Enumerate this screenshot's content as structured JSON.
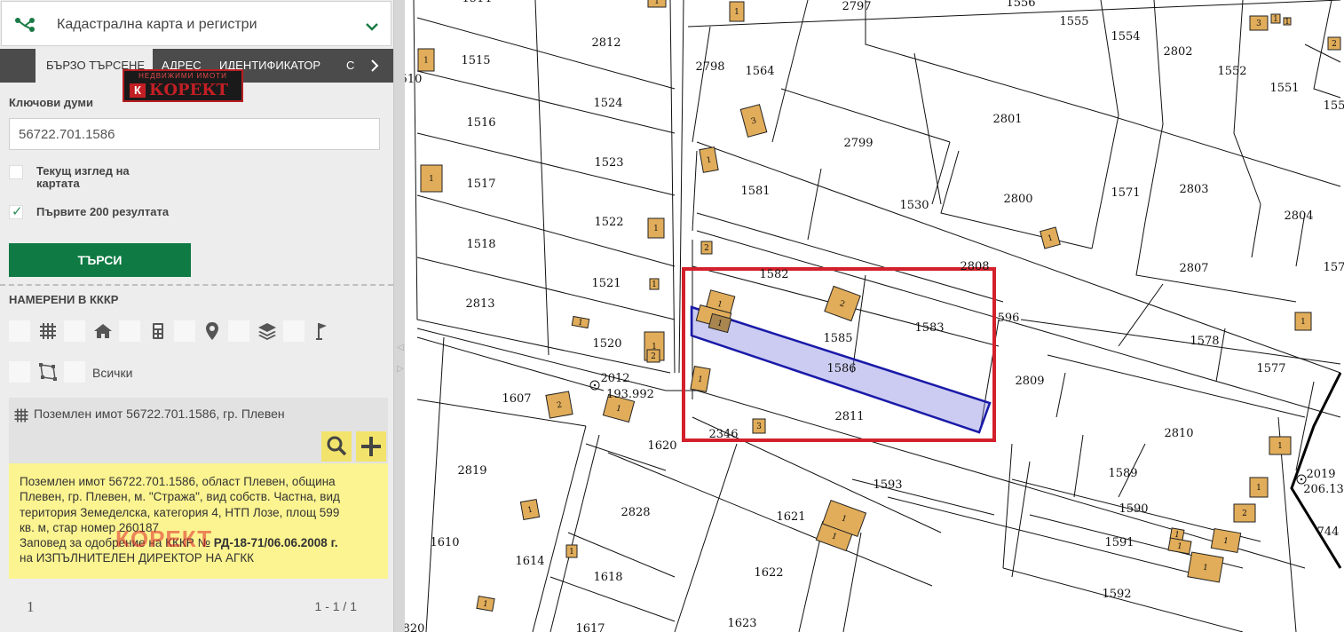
{
  "layer_selector": {
    "label": "Кадастрална карта и регистри",
    "icon": "layers-tree-icon",
    "chevron": "chevron-down-icon"
  },
  "tabs": [
    {
      "label": "БЪРЗО ТЪРСЕНЕ",
      "active": true
    },
    {
      "label": "АДРЕС"
    },
    {
      "label": "ИДЕНТИФИКАТОР"
    },
    {
      "label": "С"
    }
  ],
  "tabs_next_icon": "chevron-right-icon",
  "watermark_logo": {
    "top": "НЕДВИЖИМИ ИМОТИ",
    "mark": "К",
    "name": "КОРЕКТ"
  },
  "search": {
    "keywords_label": "Ключови думи",
    "keywords_value": "56722.701.1586",
    "current_view_label_line1": "Текущ изглед на",
    "current_view_label_line2": "картата",
    "current_view_checked": false,
    "first200_label": "Първите 200 резултата",
    "first200_checked": true,
    "button_label": "ТЪРСИ"
  },
  "found": {
    "heading": "НАМЕРЕНИ В КККР",
    "filters": [
      "grid-icon",
      "home-icon",
      "calculator-icon",
      "pin-icon",
      "layers-icon",
      "flag-icon",
      "polygon-icon"
    ],
    "all_label": "Всички"
  },
  "result": {
    "title": "Поземлен имот 56722.701.1586, гр. Плевен",
    "icon": "grid-icon",
    "actions": [
      "search-icon",
      "plus-icon"
    ],
    "details_line1": "Поземлен имот 56722.701.1586, област Плевен, община",
    "details_line2": "Плевен, гр. Плевен, м. \"Стража\", вид собств. Частна, вид",
    "details_line3": "територия Земеделска, категория 4, НТП Лозе, площ 599",
    "details_line4": "кв. м, стар номер 260187",
    "order_prefix": "Заповед за одобрение на КККР №",
    "order_number": "РД-18-71/06.06.2008 г.",
    "order_issuer": "на ИЗПЪЛНИТЕЛЕН ДИРЕКТОР НА АГКК",
    "watermark": "КОРЕКТ"
  },
  "pager": {
    "page": "1",
    "range": "1 - 1 / 1"
  },
  "map": {
    "highlight_color": "#1a1aa8",
    "frame_color": "#d3202a",
    "building_color": "#e1ad5a",
    "parcels": [
      "2797",
      "1556",
      "1555",
      "1554",
      "2802",
      "1552",
      "1551",
      "155",
      "2812",
      "1515",
      "1564",
      "1524",
      "2801",
      "2798",
      "1516",
      "2799",
      "1523",
      "1517",
      "1581",
      "1530",
      "2800",
      "1571",
      "2803",
      "2804",
      "1522",
      "1518",
      "2808",
      "2807",
      "157",
      "1582",
      "1521",
      "2813",
      "1583",
      "596",
      "1578",
      "1520",
      "1585",
      "1577",
      "1586",
      "2809",
      "2012",
      "193.992",
      "1607",
      "2811",
      "2810",
      "1620",
      "2346",
      "1589",
      "2819",
      "1593",
      "2019",
      "206.13",
      "2828",
      "1621",
      "1590",
      "744",
      "1610",
      "1614",
      "1591",
      "1618",
      "1622",
      "1592",
      "1617",
      "1623",
      "820",
      "510",
      "1514"
    ],
    "building_labels": [
      "1",
      "1",
      "1",
      "3",
      "1",
      "1",
      "1",
      "2",
      "1",
      "1",
      "2",
      "1",
      "1",
      "1",
      "1",
      "1",
      "2",
      "3",
      "1",
      "1",
      "1",
      "1",
      "2",
      "1",
      "1",
      "1",
      "1",
      "1",
      "1",
      "1",
      "1",
      "1",
      "3",
      "1",
      "1",
      "2",
      "1",
      "2"
    ]
  }
}
